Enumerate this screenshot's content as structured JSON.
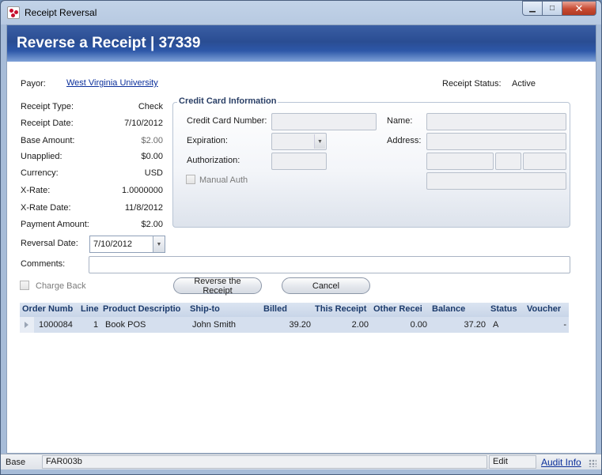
{
  "window": {
    "title": "Receipt Reversal"
  },
  "banner": {
    "title": "Reverse a Receipt  |  37339"
  },
  "payor": {
    "label": "Payor:",
    "value": "West Virginia University"
  },
  "receipt_status": {
    "label": "Receipt Status:",
    "value": "Active"
  },
  "fields": {
    "receipt_type": {
      "label": "Receipt Type:",
      "value": "Check"
    },
    "receipt_date": {
      "label": "Receipt Date:",
      "value": "7/10/2012"
    },
    "base_amount": {
      "label": "Base Amount:",
      "value": "$2.00"
    },
    "unapplied": {
      "label": "Unapplied:",
      "value": "$0.00"
    },
    "currency": {
      "label": "Currency:",
      "value": "USD"
    },
    "x_rate": {
      "label": "X-Rate:",
      "value": "1.0000000"
    },
    "x_rate_date": {
      "label": "X-Rate Date:",
      "value": "11/8/2012"
    },
    "payment_amount": {
      "label": "Payment Amount:",
      "value": "$2.00"
    }
  },
  "reversal_date": {
    "label": "Reversal Date:",
    "value": "7/10/2012"
  },
  "comments": {
    "label": "Comments:",
    "value": ""
  },
  "credit_card": {
    "legend": "Credit Card Information",
    "number_label": "Credit Card Number:",
    "expiration_label": "Expiration:",
    "authorization_label": "Authorization:",
    "manual_auth_label": "Manual Auth",
    "name_label": "Name:",
    "address_label": "Address:"
  },
  "charge_back": {
    "label": "Charge Back"
  },
  "buttons": {
    "reverse": "Reverse the Receipt",
    "cancel": "Cancel"
  },
  "grid": {
    "headers": [
      "Order Numb",
      "Line",
      "Product Descriptio",
      "Ship-to",
      "Billed",
      "This Receipt",
      "Other Recei",
      "Balance",
      "Status",
      "Voucher"
    ],
    "rows": [
      {
        "order": "1000084",
        "line": "1",
        "product": "Book POS",
        "ship_to": "John Smith",
        "billed": "39.20",
        "this_receipt": "2.00",
        "other": "0.00",
        "balance": "37.20",
        "status": "A",
        "voucher": "-"
      }
    ]
  },
  "statusbar": {
    "base": "Base",
    "form": "FAR003b",
    "mode": "Edit",
    "audit": "Audit Info"
  },
  "colors": {
    "banner": "#2a4d93",
    "link": "#0b2f9b",
    "grid_row": "#d5dfee"
  }
}
